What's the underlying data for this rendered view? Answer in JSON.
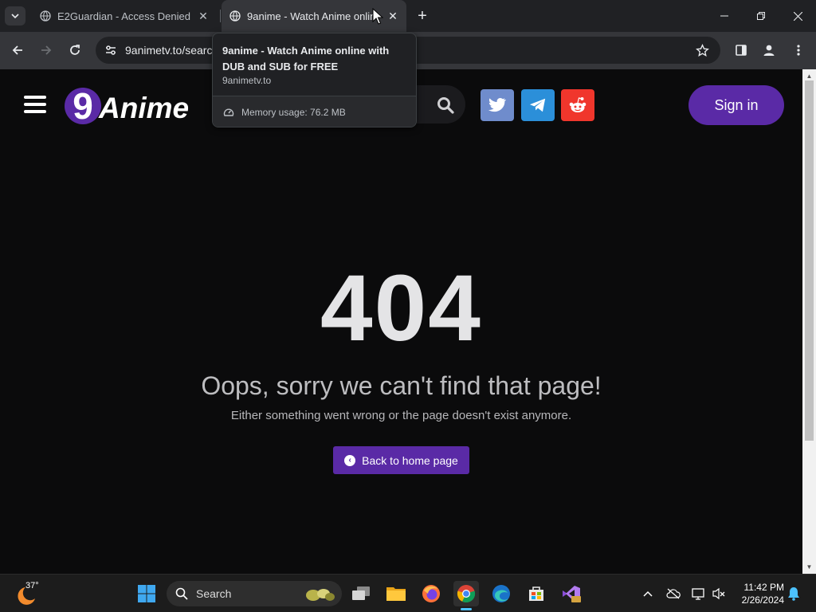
{
  "browser": {
    "tabs": [
      {
        "title": "E2Guardian - Access Denied",
        "active": false
      },
      {
        "title": "9anime - Watch Anime online",
        "active": true
      }
    ],
    "address_bar": {
      "url": "9animetv.to/search"
    },
    "hover_card": {
      "title": "9anime - Watch Anime online with DUB and SUB for FREE",
      "domain": "9animetv.to",
      "memory": "Memory usage: 76.2 MB"
    }
  },
  "site": {
    "logo_text": "9Anime",
    "signin_label": "Sign in",
    "social": [
      "twitter",
      "telegram",
      "reddit"
    ],
    "colors": {
      "accent": "#5a2aa6",
      "background": "#0b0b0c"
    }
  },
  "error": {
    "code": "404",
    "title": "Oops, sorry we can't find that page!",
    "subtitle": "Either something went wrong or the page doesn't exist anymore.",
    "home_button": "Back to home page"
  },
  "taskbar": {
    "weather_temp": "37°",
    "search_label": "Search",
    "time": "11:42 PM",
    "date": "2/26/2024",
    "apps": [
      "start",
      "search",
      "task-view",
      "file-explorer",
      "firefox",
      "chrome",
      "edge",
      "microsoft-store",
      "visual-studio-preview"
    ]
  }
}
